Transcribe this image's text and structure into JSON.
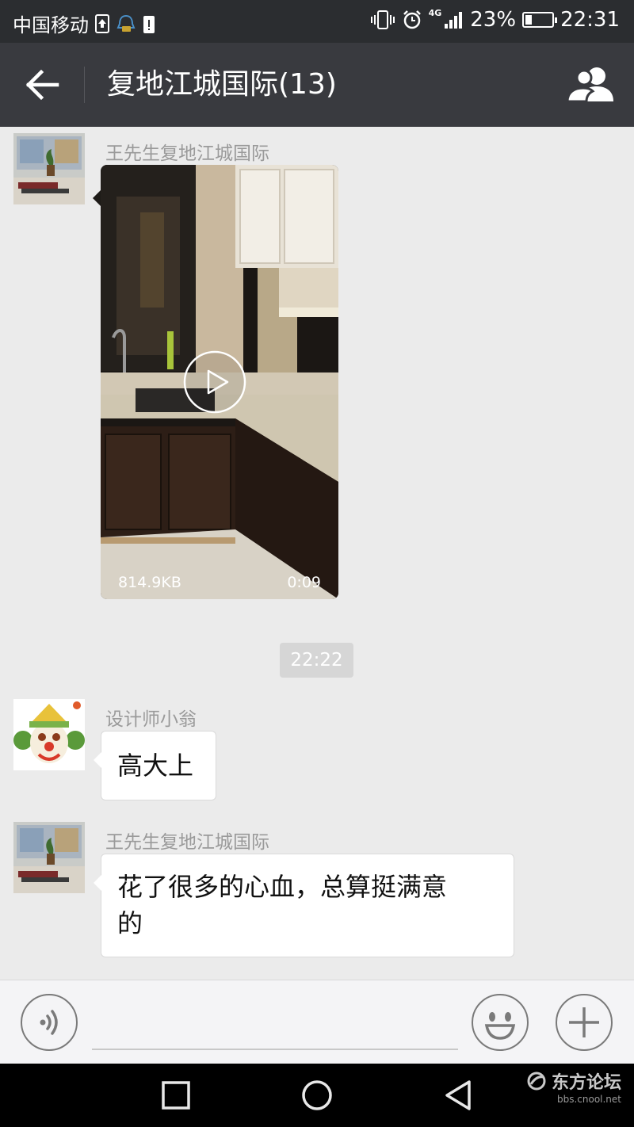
{
  "status_bar": {
    "carrier": "中国移动",
    "network": "4G",
    "battery_percent": "23%",
    "battery_level": 0.23,
    "time": "22:31"
  },
  "title_bar": {
    "title": "复地江城国际(13)",
    "back_icon": "arrow-left-icon",
    "group_icon": "group-members-icon"
  },
  "messages": [
    {
      "sender": "王先生复地江城国际",
      "type": "video",
      "video_size": "814.9KB",
      "video_duration": "0:09"
    },
    {
      "type": "timestamp",
      "text": "22:22"
    },
    {
      "sender": "设计师小翁",
      "type": "text",
      "text": "高大上"
    },
    {
      "sender": "王先生复地江城国际",
      "type": "text",
      "text_line1": "花了很多的心血，总算挺满意",
      "text_line2": "的"
    }
  ],
  "input_bar": {
    "voice_icon": "voice-icon",
    "emoji_icon": "emoji-icon",
    "plus_icon": "plus-icon"
  },
  "nav_bar": {
    "recent_icon": "recent-apps-icon",
    "home_icon": "home-icon",
    "back_icon": "back-triangle-icon"
  },
  "watermark": {
    "name": "东方论坛",
    "url": "bbs.cnool.net"
  },
  "colors": {
    "status_bar_bg": "#2b2d30",
    "title_bar_bg": "#393a3f",
    "chat_bg": "#ebebeb",
    "bubble_bg": "#ffffff"
  }
}
